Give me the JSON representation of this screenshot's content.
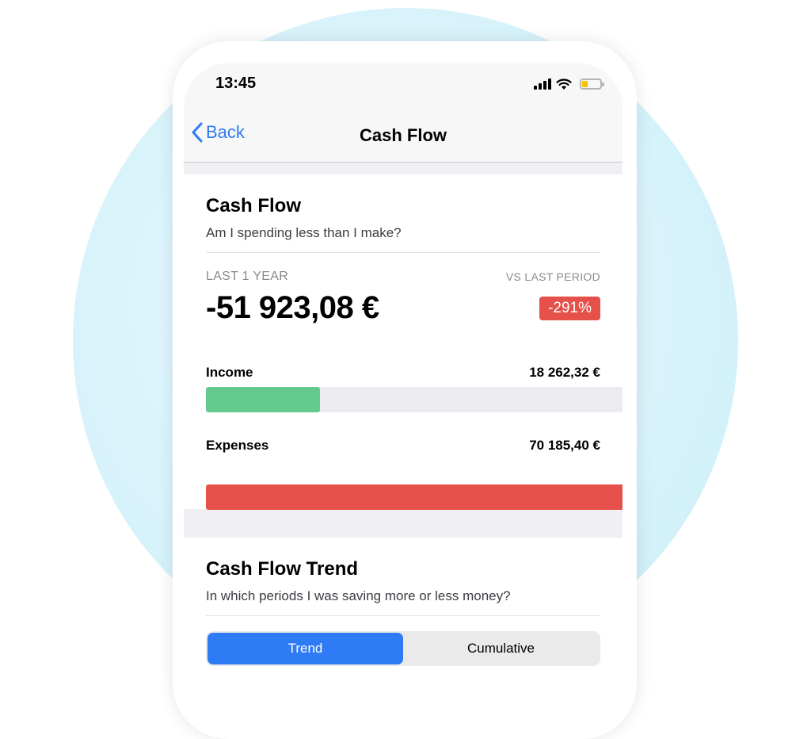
{
  "status_bar": {
    "time": "13:45",
    "battery_color": "#f5c400"
  },
  "nav": {
    "back_label": "Back",
    "title": "Cash Flow",
    "accent": "#2f7bf5"
  },
  "cash_flow_card": {
    "title": "Cash Flow",
    "subtitle": "Am I spending less than I make?",
    "period_label": "LAST 1 YEAR",
    "compare_label": "VS LAST PERIOD",
    "amount": "-51 923,08 €",
    "change_badge": "-291%",
    "badge_color": "#e5514a",
    "income": {
      "label": "Income",
      "value": "18 262,32 €",
      "fill_fraction": 0.26,
      "color": "#63c98d"
    },
    "expenses": {
      "label": "Expenses",
      "value": "70 185,40 €",
      "fill_fraction": 1.0,
      "color": "#e5514a"
    }
  },
  "trend_card": {
    "title": "Cash Flow Trend",
    "subtitle": "In which periods I was saving more or less money?",
    "segments": [
      {
        "label": "Trend",
        "active": true
      },
      {
        "label": "Cumulative",
        "active": false
      }
    ]
  }
}
